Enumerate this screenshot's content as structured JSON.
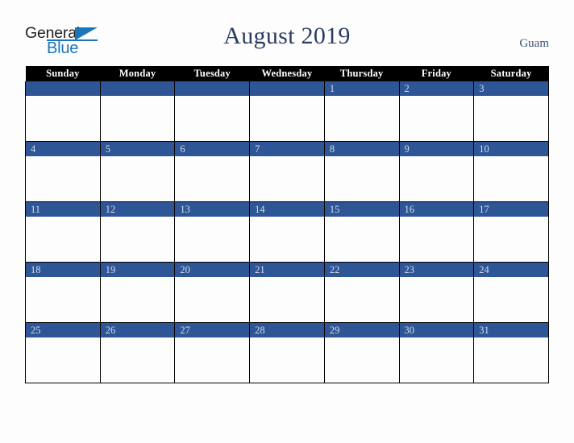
{
  "brand": {
    "name_part1": "General",
    "name_part2": "Blue",
    "triangle_icon": "triangle-icon"
  },
  "header": {
    "title": "August 2019",
    "locale": "Guam"
  },
  "colors": {
    "header_row_bg": "#000000",
    "header_row_text": "#ffffff",
    "day_banner_bg": "#2e5596",
    "day_number_text": "#d5dced",
    "title_text": "#2b3c62",
    "locale_text": "#3c4f77",
    "brand_blue": "#1b75bb",
    "brand_dark": "#231f20",
    "page_bg": "#fdfdfd",
    "cell_border": "#000000"
  },
  "calendar": {
    "weekdays": [
      "Sunday",
      "Monday",
      "Tuesday",
      "Wednesday",
      "Thursday",
      "Friday",
      "Saturday"
    ],
    "weeks": [
      [
        {
          "day": ""
        },
        {
          "day": ""
        },
        {
          "day": ""
        },
        {
          "day": ""
        },
        {
          "day": "1"
        },
        {
          "day": "2"
        },
        {
          "day": "3"
        }
      ],
      [
        {
          "day": "4"
        },
        {
          "day": "5"
        },
        {
          "day": "6"
        },
        {
          "day": "7"
        },
        {
          "day": "8"
        },
        {
          "day": "9"
        },
        {
          "day": "10"
        }
      ],
      [
        {
          "day": "11"
        },
        {
          "day": "12"
        },
        {
          "day": "13"
        },
        {
          "day": "14"
        },
        {
          "day": "15"
        },
        {
          "day": "16"
        },
        {
          "day": "17"
        }
      ],
      [
        {
          "day": "18"
        },
        {
          "day": "19"
        },
        {
          "day": "20"
        },
        {
          "day": "21"
        },
        {
          "day": "22"
        },
        {
          "day": "23"
        },
        {
          "day": "24"
        }
      ],
      [
        {
          "day": "25"
        },
        {
          "day": "26"
        },
        {
          "day": "27"
        },
        {
          "day": "28"
        },
        {
          "day": "29"
        },
        {
          "day": "30"
        },
        {
          "day": "31"
        }
      ]
    ]
  }
}
